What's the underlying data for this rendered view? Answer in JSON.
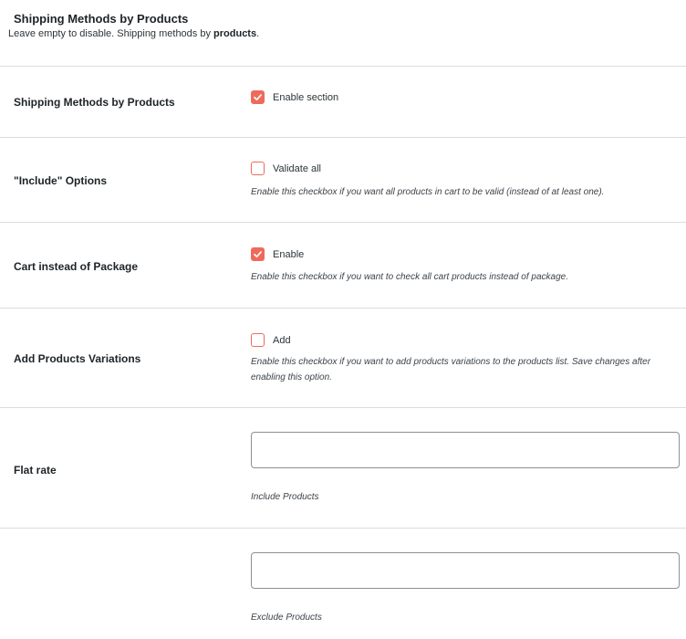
{
  "section": {
    "title": "Shipping Methods by Products",
    "description_prefix": "Leave empty to disable. Shipping methods by ",
    "description_bold": "products",
    "description_suffix": "."
  },
  "rows": {
    "enable": {
      "label": "Shipping Methods by Products",
      "checkbox_label": "Enable section",
      "checked": true
    },
    "include_options": {
      "label": "\"Include\" Options",
      "checkbox_label": "Validate all",
      "checked": false,
      "help": "Enable this checkbox if you want all products in cart to be valid (instead of at least one)."
    },
    "cart_instead": {
      "label": "Cart instead of Package",
      "checkbox_label": "Enable",
      "checked": true,
      "help": "Enable this checkbox if you want to check all cart products instead of package."
    },
    "variations": {
      "label": "Add Products Variations",
      "checkbox_label": "Add",
      "checked": false,
      "help": "Enable this checkbox if you want to add products variations to the products list. Save changes after enabling this option."
    },
    "flat_rate": {
      "label": "Flat rate",
      "include_value": "",
      "include_help": "Include Products",
      "exclude_value": "",
      "exclude_help": "Exclude Products"
    }
  },
  "colors": {
    "accent": "#ee6b5c",
    "divider": "#dcdcde"
  },
  "icons": {
    "checkmark": "check-icon"
  }
}
